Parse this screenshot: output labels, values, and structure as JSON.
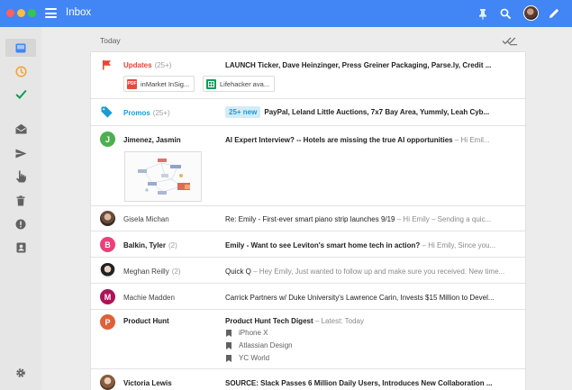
{
  "app": {
    "title": "Inbox"
  },
  "colors": {
    "topbar": "#4285f4",
    "updates": "#ea4335",
    "promos": "#1a9bd7",
    "done": "#0f9d58",
    "snooze": "#f4a230"
  },
  "topbar_icons": [
    "pin-icon",
    "search-icon",
    "avatar",
    "compose-icon"
  ],
  "rail_icons": [
    "inbox-icon",
    "snoozed-icon",
    "done-icon",
    "drafts-icon",
    "sent-icon",
    "reminders-icon",
    "trash-icon",
    "spam-icon",
    "contacts-icon",
    "settings-icon"
  ],
  "section": {
    "title": "Today"
  },
  "bundles": {
    "updates": {
      "label": "Updates",
      "count": "(25+)",
      "subject": "LAUNCH Ticker, Dave Heinzinger, Press Greiner Packaging, Parse.ly, Credit ...",
      "chips": [
        {
          "badge": "PDF",
          "label": "inMarket InSig..."
        },
        {
          "badge": "",
          "label": "Lifehacker ava..."
        }
      ]
    },
    "promos": {
      "label": "Promos",
      "count": "(25+)",
      "badge": "25+ new",
      "subject": "PayPal, Leland Little Auctions, 7x7 Bay Area, Yummly, Leah Cyb..."
    }
  },
  "emails": [
    {
      "avatar_letter": "J",
      "avatar_color": "#4caf50",
      "sender": "Jimenez, Jasmin",
      "count": "",
      "subject": "AI Expert Interview? -- Hotels are missing the true AI opportunities",
      "snippet": " – Hi Emil...",
      "unread": true
    },
    {
      "avatar_letter": "",
      "avatar_color": "",
      "sender": "Gisela Michan",
      "count": "",
      "subject": "Re: Emily - First-ever smart piano strip launches 9/19",
      "snippet": " – Hi Emily – Sending a quic...",
      "unread": false
    },
    {
      "avatar_letter": "B",
      "avatar_color": "#ec407a",
      "sender": "Balkin, Tyler",
      "count": "(2)",
      "subject": "Emily - Want to see Leviton's smart home tech in action?",
      "snippet": " – Hi Emily, Since you...",
      "unread": true
    },
    {
      "avatar_letter": "",
      "avatar_color": "",
      "sender": "Meghan Reilly",
      "count": "(2)",
      "subject": "Quick Q",
      "snippet": " – Hey Emily, Just wanted to follow up and make sure you received. New time...",
      "unread": false
    },
    {
      "avatar_letter": "M",
      "avatar_color": "#ad1457",
      "sender": "Machie Madden",
      "count": "",
      "subject": "Carrick Partners w/ Duke University's Lawrence Carin, Invests $15 Million to Devel...",
      "snippet": "",
      "unread": false
    },
    {
      "avatar_letter": "P",
      "avatar_color": "#e0603a",
      "sender": "Product Hunt",
      "count": "",
      "subject": "Product Hunt Tech Digest",
      "snippet": " – Latest: Today",
      "unread": true,
      "digest_items": [
        "iPhone X",
        "Atlassian Design",
        "YC World"
      ]
    },
    {
      "avatar_letter": "",
      "avatar_color": "",
      "sender": "Victoria Lewis",
      "count": "",
      "subject": "SOURCE: Slack Passes 6 Million Daily Users, Introduces New Collaboration ...",
      "snippet": "",
      "unread": true
    }
  ]
}
